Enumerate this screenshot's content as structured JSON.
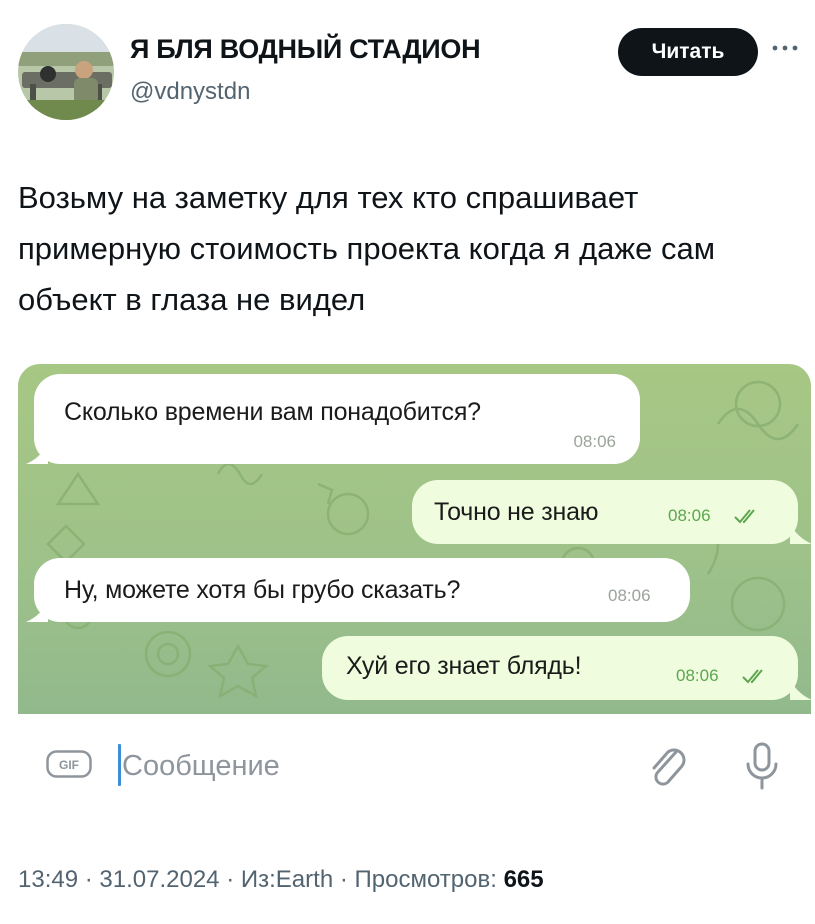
{
  "author": {
    "display_name": "Я БЛЯ ВОДНЫЙ СТАДИОН",
    "handle": "@vdnystdn",
    "avatar_icon": "profile-photo"
  },
  "follow_button": {
    "label": "Читать"
  },
  "more_icon": "ellipsis-icon",
  "tweet": {
    "text": "Возьму на заметку для тех кто спрашивает примерную стоимость проекта когда я даже сам объект в глаза не видел"
  },
  "chat": {
    "messages": [
      {
        "direction": "in",
        "text": "Сколько времени вам понадобится?",
        "time": "08:06"
      },
      {
        "direction": "out",
        "text": "Точно не знаю",
        "time": "08:06",
        "status_icon": "double-check-icon"
      },
      {
        "direction": "in",
        "text": "Ну, можете хотя бы грубо сказать?",
        "time": "08:06"
      },
      {
        "direction": "out",
        "text": "Хуй его знает блядь!",
        "time": "08:06",
        "status_icon": "double-check-icon"
      }
    ],
    "input": {
      "placeholder": "Сообщение",
      "value": ""
    },
    "colors": {
      "background": "#9dc18a",
      "incoming": "#ffffff",
      "outgoing": "#effdde",
      "check": "#5da64f"
    }
  },
  "meta": {
    "time": "13:49",
    "date": "31.07.2024",
    "source": "Из:Earth",
    "views_label": "Просмотров:",
    "views_count": "665"
  }
}
